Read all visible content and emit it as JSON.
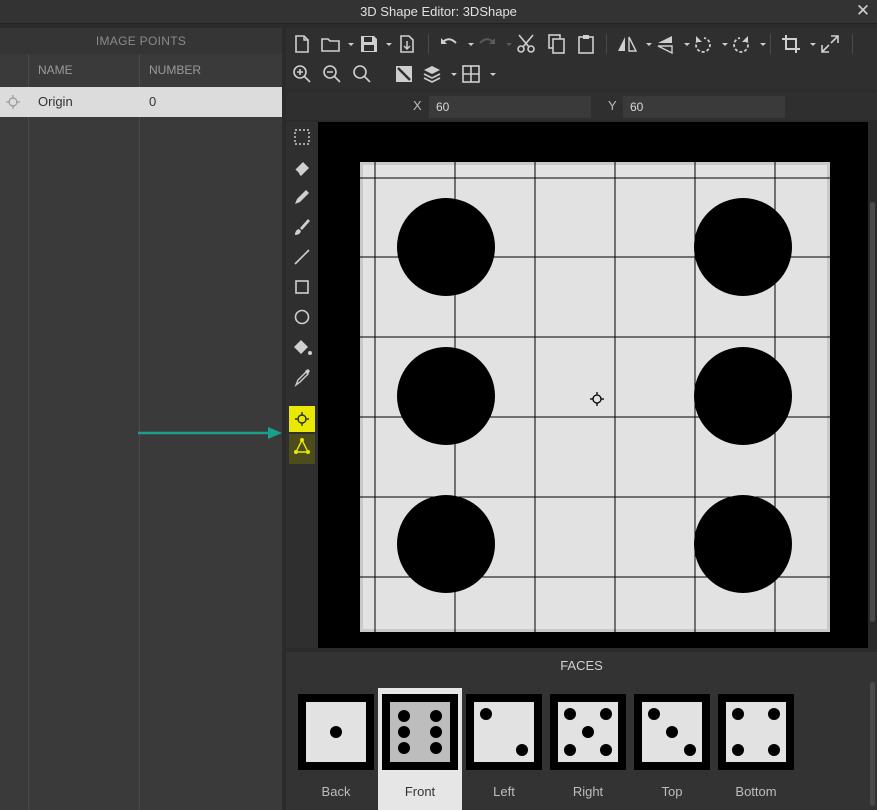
{
  "window": {
    "title": "3D Shape Editor: 3DShape",
    "close_glyph": "✕"
  },
  "image_points": {
    "header": "IMAGE POINTS",
    "columns": [
      "NAME",
      "NUMBER"
    ],
    "rows": [
      {
        "name": "Origin",
        "number": "0"
      }
    ]
  },
  "coords": {
    "x_label": "X",
    "x_value": "60",
    "y_label": "Y",
    "y_value": "60"
  },
  "toolbar": {
    "row1": [
      "new-file",
      "open-folder",
      "save",
      "export",
      "undo",
      "redo",
      "cut",
      "copy",
      "paste",
      "flip-horizontal",
      "flip-vertical",
      "rotate-left",
      "rotate-right",
      "crop",
      "fullscreen"
    ],
    "row2": [
      "zoom-in",
      "zoom-out",
      "zoom-fit",
      "color-swap",
      "layers",
      "grid"
    ]
  },
  "tools": [
    "select",
    "eraser",
    "pencil",
    "brush",
    "line",
    "rectangle",
    "ellipse",
    "fill",
    "eyedropper",
    "image-point",
    "triangle-tool"
  ],
  "active_tool": "image-point",
  "colors": {
    "accent_yellow": "#e8e800",
    "arrow": "#19a08a",
    "canvas_bg": "#000000",
    "face_bg": "#e2e2e2"
  },
  "faces": {
    "header": "FACES",
    "items": [
      {
        "name": "Back",
        "pips": 1
      },
      {
        "name": "Front",
        "pips": 6,
        "selected": true
      },
      {
        "name": "Left",
        "pips": 2
      },
      {
        "name": "Right",
        "pips": 5
      },
      {
        "name": "Top",
        "pips": 3
      },
      {
        "name": "Bottom",
        "pips": 4
      }
    ]
  }
}
